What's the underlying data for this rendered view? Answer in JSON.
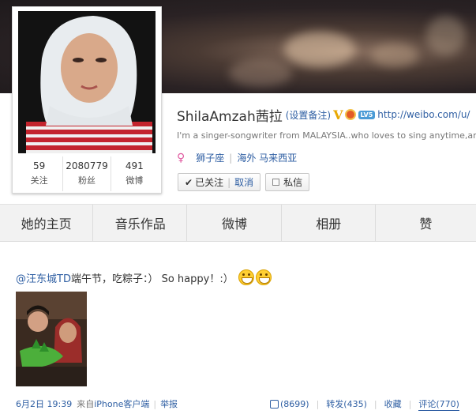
{
  "profile": {
    "username": "ShilaAmzah茜拉",
    "remark_label": "(设置备注)",
    "verified_icon": "verified-v-icon",
    "vip_label": "LV5",
    "url": "http://weibo.com/u/",
    "bio": "I'm a singer-songwriter from MALAYSIA..who loves to sing anytime,any",
    "zodiac": "狮子座",
    "location": "海外 马来西亚",
    "stats": [
      {
        "value": "59",
        "label": "关注"
      },
      {
        "value": "2080779",
        "label": "粉丝"
      },
      {
        "value": "491",
        "label": "微博"
      }
    ],
    "follow_label": "已关注",
    "cancel_label": "取消",
    "message_label": "私信"
  },
  "nav": {
    "tabs": [
      "她的主页",
      "音乐作品",
      "微博",
      "相册",
      "赞"
    ]
  },
  "post": {
    "mention": "@汪东城TD",
    "text": " 端午节，吃粽子：）  So happy！:）",
    "time": "6月2日 19:39",
    "from_label": "来自",
    "source": "iPhone客户端",
    "report": "举报",
    "likes": "(8699)",
    "repost": "转发(435)",
    "favorite": "收藏",
    "comment": "评论(770)"
  },
  "colors": {
    "link": "#2f5fa3",
    "nav_bg": "#f2f2f2"
  }
}
